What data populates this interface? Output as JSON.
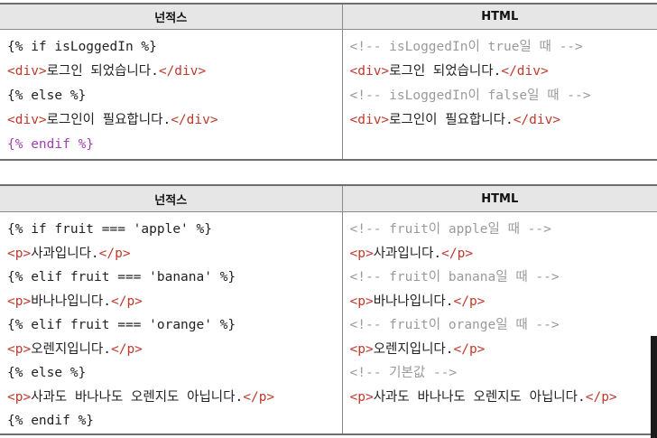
{
  "tables": [
    {
      "header_left": "넌적스",
      "header_right": "HTML",
      "left_lines": [
        [
          {
            "t": "{% if isLoggedIn %}",
            "c": ""
          }
        ],
        [
          {
            "t": "<div>",
            "c": "tag"
          },
          {
            "t": "로그인 되었습니다.",
            "c": ""
          },
          {
            "t": "</div>",
            "c": "tag"
          }
        ],
        [
          {
            "t": "{% else %}",
            "c": ""
          }
        ],
        [
          {
            "t": "<div>",
            "c": "tag"
          },
          {
            "t": "로그인이 필요합니다.",
            "c": ""
          },
          {
            "t": "</div>",
            "c": "tag"
          }
        ],
        [
          {
            "t": "{% endif %}",
            "c": "kw-purple"
          }
        ]
      ],
      "right_lines": [
        [
          {
            "t": "<!-- isLoggedIn이 true일 때 -->",
            "c": "cmt"
          }
        ],
        [
          {
            "t": "<div>",
            "c": "tag"
          },
          {
            "t": "로그인 되었습니다.",
            "c": ""
          },
          {
            "t": "</div>",
            "c": "tag"
          }
        ],
        [
          {
            "t": "<!-- isLoggedIn이 false일 때 -->",
            "c": "cmt"
          }
        ],
        [
          {
            "t": "<div>",
            "c": "tag"
          },
          {
            "t": "로그인이 필요합니다.",
            "c": ""
          },
          {
            "t": "</div>",
            "c": "tag"
          }
        ]
      ]
    },
    {
      "header_left": "넌적스",
      "header_right": "HTML",
      "left_lines": [
        [
          {
            "t": "{% if fruit === 'apple' %}",
            "c": ""
          }
        ],
        [
          {
            "t": "<p>",
            "c": "tag"
          },
          {
            "t": "사과입니다.",
            "c": ""
          },
          {
            "t": "</p>",
            "c": "tag"
          }
        ],
        [
          {
            "t": "{% elif fruit === 'banana' %}",
            "c": ""
          }
        ],
        [
          {
            "t": "<p>",
            "c": "tag"
          },
          {
            "t": "바나나입니다.",
            "c": ""
          },
          {
            "t": "</p>",
            "c": "tag"
          }
        ],
        [
          {
            "t": "{% elif fruit === 'orange' %}",
            "c": ""
          }
        ],
        [
          {
            "t": "<p>",
            "c": "tag"
          },
          {
            "t": "오렌지입니다.",
            "c": ""
          },
          {
            "t": "</p>",
            "c": "tag"
          }
        ],
        [
          {
            "t": "{% else %}",
            "c": ""
          }
        ],
        [
          {
            "t": "<p>",
            "c": "tag"
          },
          {
            "t": "사과도 바나나도 오렌지도 아닙니다.",
            "c": ""
          },
          {
            "t": "</p>",
            "c": "tag"
          }
        ],
        [
          {
            "t": "{% endif %}",
            "c": ""
          }
        ]
      ],
      "right_lines": [
        [
          {
            "t": "<!-- fruit이 apple일 때 -->",
            "c": "cmt"
          }
        ],
        [
          {
            "t": "<p>",
            "c": "tag"
          },
          {
            "t": "사과입니다.",
            "c": ""
          },
          {
            "t": "</p>",
            "c": "tag"
          }
        ],
        [
          {
            "t": "<!-- fruit이 banana일 때 -->",
            "c": "cmt"
          }
        ],
        [
          {
            "t": "<p>",
            "c": "tag"
          },
          {
            "t": "바나나입니다.",
            "c": ""
          },
          {
            "t": "</p>",
            "c": "tag"
          }
        ],
        [
          {
            "t": "<!-- fruit이 orange일 때 -->",
            "c": "cmt"
          }
        ],
        [
          {
            "t": "<p>",
            "c": "tag"
          },
          {
            "t": "오렌지입니다.",
            "c": ""
          },
          {
            "t": "</p>",
            "c": "tag"
          }
        ],
        [
          {
            "t": "<!-- 기본값 -->",
            "c": "cmt"
          }
        ],
        [
          {
            "t": "<p>",
            "c": "tag"
          },
          {
            "t": "사과도 바나나도 오렌지도 아닙니다.",
            "c": ""
          },
          {
            "t": "</p>",
            "c": "tag"
          }
        ]
      ]
    }
  ],
  "colors": {
    "tag": "#c0392b",
    "comment": "#9a9a9a",
    "keyword_purple": "#a040b0",
    "header_bg": "#e6e6e6"
  }
}
